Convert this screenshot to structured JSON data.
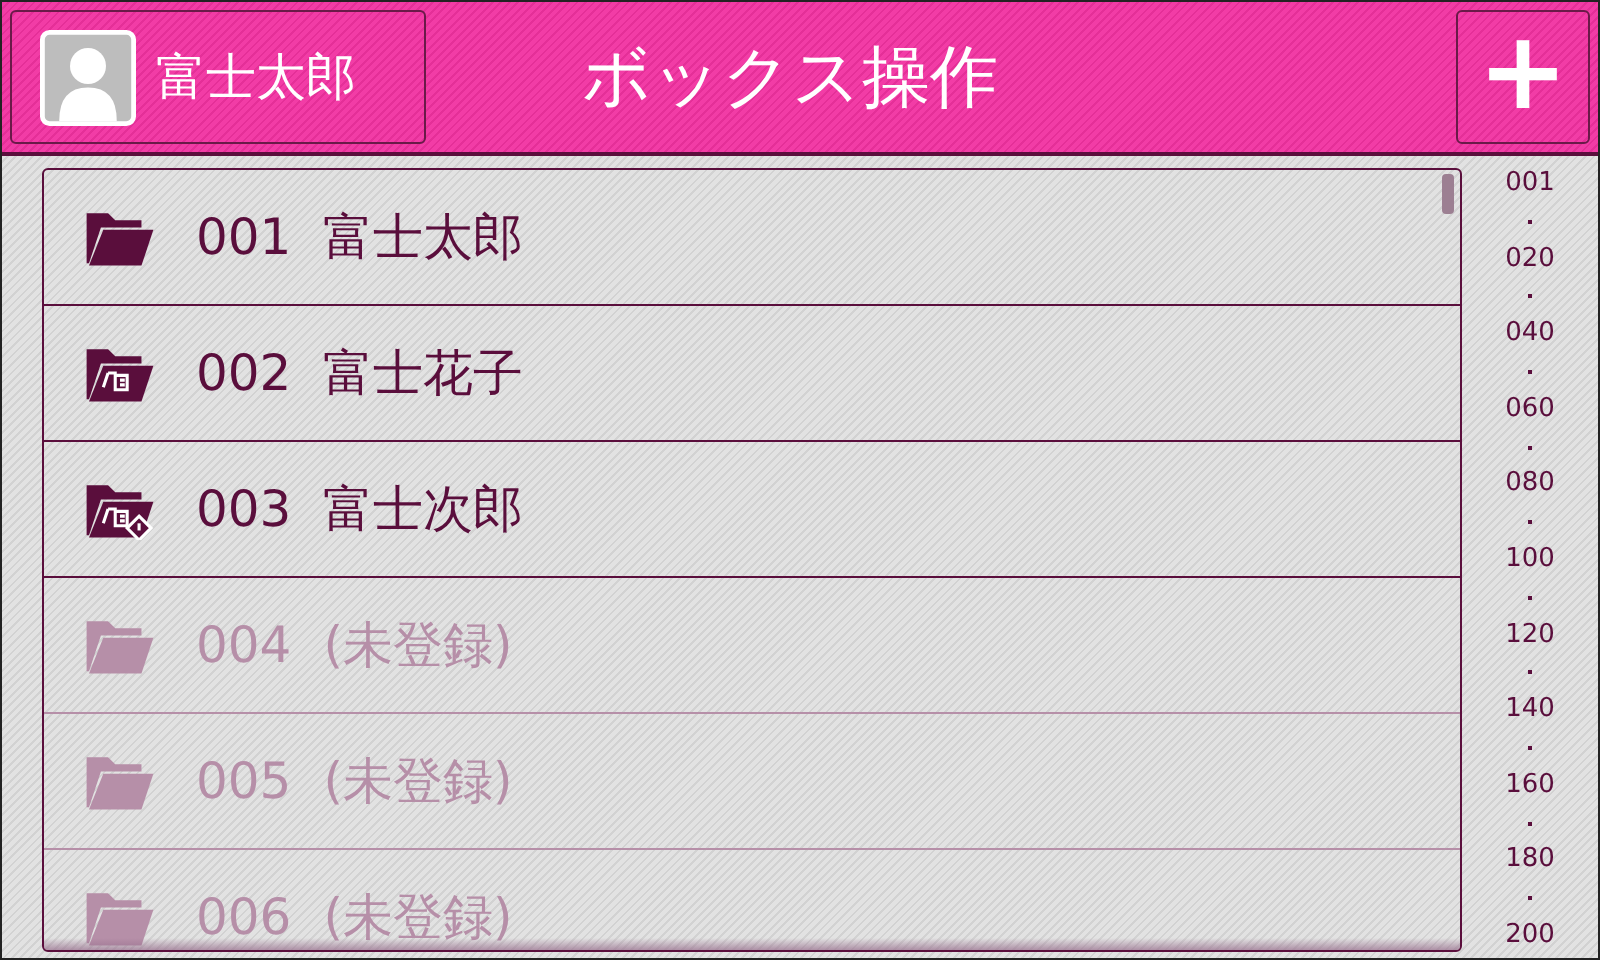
{
  "header": {
    "user": {
      "name": "富士太郎"
    },
    "title": "ボックス操作",
    "add_button": {
      "label": "+"
    }
  },
  "boxes": [
    {
      "number": "001",
      "name": "富士太郎",
      "kind": "folder",
      "registered": true
    },
    {
      "number": "002",
      "name": "富士花子",
      "kind": "folder-doc",
      "registered": true
    },
    {
      "number": "003",
      "name": "富士次郎",
      "kind": "folder-doc-lock",
      "registered": true
    },
    {
      "number": "004",
      "name": "(未登録)",
      "kind": "folder",
      "registered": false
    },
    {
      "number": "005",
      "name": "(未登録)",
      "kind": "folder",
      "registered": false
    },
    {
      "number": "006",
      "name": "(未登録)",
      "kind": "folder",
      "registered": false
    }
  ],
  "index": [
    "001",
    "020",
    "040",
    "060",
    "080",
    "100",
    "120",
    "140",
    "160",
    "180",
    "200"
  ]
}
